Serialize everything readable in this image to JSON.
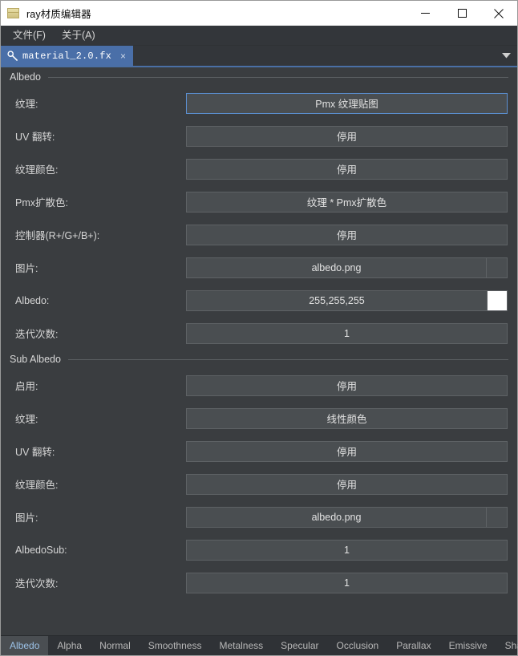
{
  "window": {
    "title": "ray材质编辑器",
    "icon": "document-icon",
    "controls": {
      "minimize": "minimize-icon",
      "maximize": "maximize-icon",
      "close": "close-icon"
    }
  },
  "menubar": {
    "items": [
      {
        "label": "文件(F)",
        "name": "menu-file"
      },
      {
        "label": "关于(A)",
        "name": "menu-about"
      }
    ]
  },
  "tabstrip": {
    "tab": {
      "icon": "wrench-icon",
      "label": "material_2.0.fx",
      "close": "×"
    },
    "overflow_icon": "chevron-down-icon",
    "accent": "#4a6fa5"
  },
  "groups": [
    {
      "title": "Albedo",
      "rows": [
        {
          "label": "纹理:",
          "value": "Pmx 纹理贴图",
          "kind": "combo",
          "focused": true
        },
        {
          "label": "UV 翻转:",
          "value": "停用",
          "kind": "combo",
          "focused": false
        },
        {
          "label": "纹理颜色:",
          "value": "停用",
          "kind": "combo",
          "focused": false
        },
        {
          "label": "Pmx扩散色:",
          "value": "纹理 * Pmx扩散色",
          "kind": "combo",
          "focused": false
        },
        {
          "label": "控制器(R+/G+/B+):",
          "value": "停用",
          "kind": "combo",
          "focused": false
        },
        {
          "label": "图片:",
          "value": "albedo.png",
          "kind": "combo-button",
          "focused": false
        },
        {
          "label": "Albedo:",
          "value": "255,255,255",
          "kind": "combo-swatch",
          "focused": false,
          "swatch": "#ffffff"
        },
        {
          "label": "迭代次数:",
          "value": "1",
          "kind": "combo",
          "focused": false
        }
      ]
    },
    {
      "title": "Sub Albedo",
      "rows": [
        {
          "label": "启用:",
          "value": "停用",
          "kind": "combo",
          "focused": false
        },
        {
          "label": "纹理:",
          "value": "线性颜色",
          "kind": "combo",
          "focused": false
        },
        {
          "label": "UV 翻转:",
          "value": "停用",
          "kind": "combo",
          "focused": false
        },
        {
          "label": "纹理颜色:",
          "value": "停用",
          "kind": "combo",
          "focused": false
        },
        {
          "label": "图片:",
          "value": "albedo.png",
          "kind": "combo-button",
          "focused": false
        },
        {
          "label": "AlbedoSub:",
          "value": "1",
          "kind": "combo",
          "focused": false
        },
        {
          "label": "迭代次数:",
          "value": "1",
          "kind": "combo",
          "focused": false
        }
      ]
    }
  ],
  "bottom_tabs": [
    {
      "label": "Albedo",
      "active": true
    },
    {
      "label": "Alpha",
      "active": false
    },
    {
      "label": "Normal",
      "active": false
    },
    {
      "label": "Smoothness",
      "active": false
    },
    {
      "label": "Metalness",
      "active": false
    },
    {
      "label": "Specular",
      "active": false
    },
    {
      "label": "Occlusion",
      "active": false
    },
    {
      "label": "Parallax",
      "active": false
    },
    {
      "label": "Emissive",
      "active": false
    },
    {
      "label": "ShadingModel",
      "active": false
    }
  ]
}
